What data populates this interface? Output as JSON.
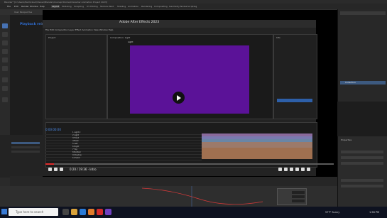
{
  "blender": {
    "title": "Blender* [C:\\Users\\Hain\\Cloud\\Owner\\Blender\\Concept Dome\\Character Animation Project 2023]",
    "menu": [
      "File",
      "Edit",
      "Render",
      "Window",
      "Help"
    ],
    "workspaces": [
      "Layout",
      "Modeling",
      "Sculpting",
      "UV Editing",
      "Texture Paint",
      "Shading",
      "Animation",
      "Rendering",
      "Compositing",
      "Geometry Nodes",
      "Scripting"
    ],
    "active_workspace": "Layout",
    "view_label": "User Perspective",
    "outliner_label": "Collection",
    "props_label": "Properties",
    "taskbar_search": "Type here to search",
    "weather": "57°F Sunny",
    "clock": "1:56 PM"
  },
  "video": {
    "title_prefix": "Playback re",
    "title_main": "ing 3D Dice Animation | After Effects Tutorial",
    "overlay_label": "Press Esc to exit full screen",
    "time": "0:20 / 19:36",
    "chapter": "Intro",
    "progress": 0.03,
    "played_color": "#e02d2d"
  },
  "after_effects": {
    "window_title": "Adobe After Effects 2023",
    "menu": [
      "File",
      "Edit",
      "Composition",
      "Layer",
      "Effect",
      "Animation",
      "View",
      "Window",
      "Help"
    ],
    "project_label": "Project",
    "comp_label": "Composition: Light",
    "comp_tab": "Light",
    "timecode": "0:00:00:00",
    "layers": [
      "1 Light 2",
      "2 Light",
      "3 Front",
      "4 Back",
      "5 Left",
      "6 Right",
      "7 Top",
      "8 Bottom",
      "9 Shadow",
      "10 Solid"
    ],
    "info_title": "Info",
    "canvas_color": "#5b1298"
  }
}
